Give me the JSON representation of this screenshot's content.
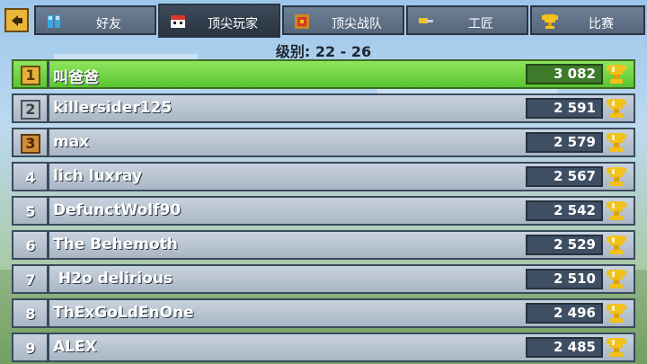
{
  "tabs": [
    {
      "label": "好友",
      "icon": "friends-icon",
      "active": false
    },
    {
      "label": "顶尖玩家",
      "icon": "player-face-icon",
      "active": true
    },
    {
      "label": "顶尖战队",
      "icon": "clan-badge-icon",
      "active": false
    },
    {
      "label": "工匠",
      "icon": "hammer-icon",
      "active": false
    },
    {
      "label": "比赛",
      "icon": "trophy-icon",
      "active": false
    }
  ],
  "level_label": "级别: 22 - 26",
  "leaderboard": [
    {
      "rank": "1",
      "name": "叫爸爸",
      "score": "3 082"
    },
    {
      "rank": "2",
      "name": "killersider125",
      "score": "2 591"
    },
    {
      "rank": "3",
      "name": "max",
      "score": "2 579"
    },
    {
      "rank": "4",
      "name": "lich luxray",
      "score": "2 567"
    },
    {
      "rank": "5",
      "name": "DefunctWolf90",
      "score": "2 542"
    },
    {
      "rank": "6",
      "name": "The Behemoth",
      "score": "2 529"
    },
    {
      "rank": "7",
      "name": " H2o delirious",
      "score": "2 510"
    },
    {
      "rank": "8",
      "name": "ThExGoLdEnOne",
      "score": "2 496"
    },
    {
      "rank": "9",
      "name": "ALEX",
      "score": "2 485"
    }
  ],
  "colors": {
    "highlight_row": "#59c530",
    "row": "#aab6c4",
    "trophy": "#f2c21a"
  }
}
